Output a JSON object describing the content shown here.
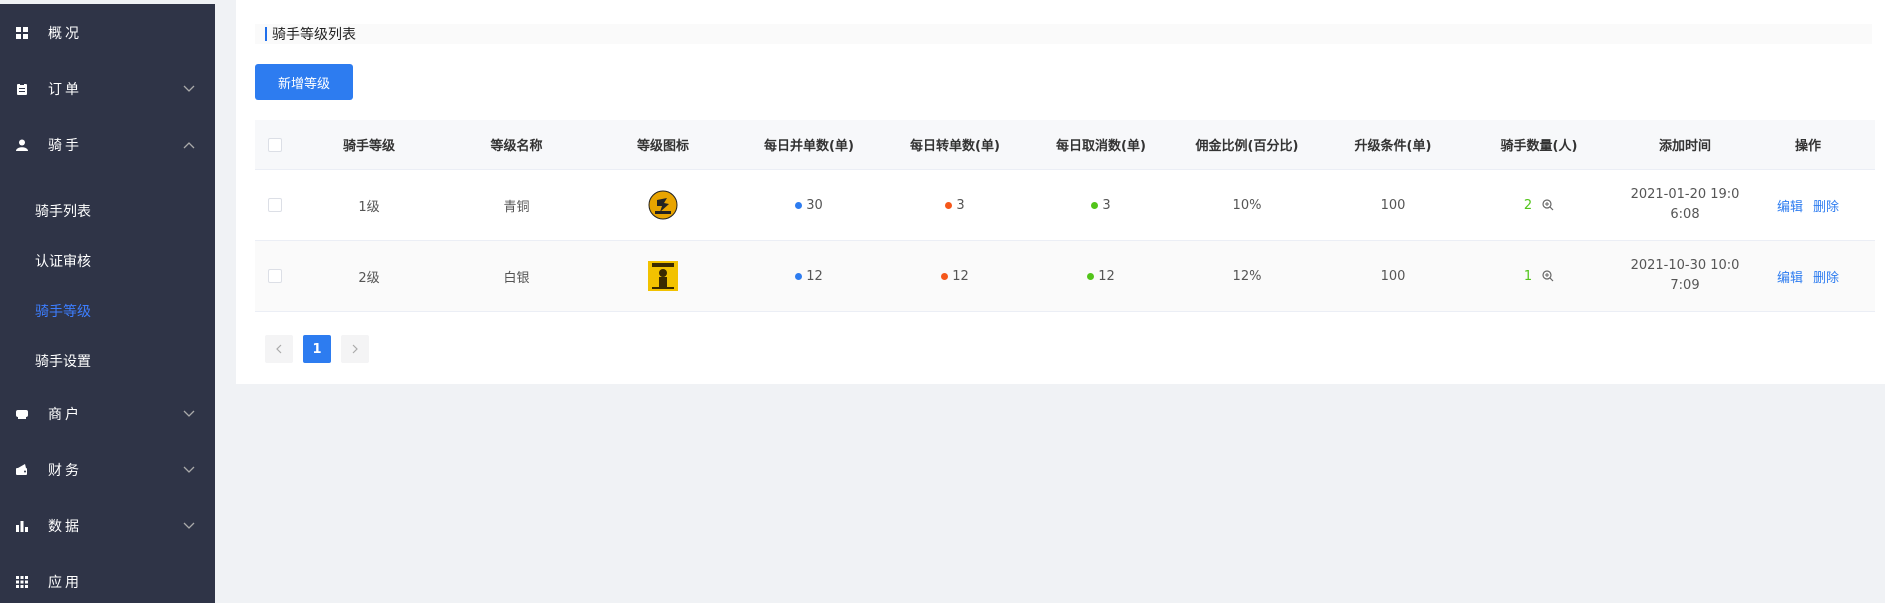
{
  "sidebar": {
    "menus": [
      {
        "label": "概况",
        "icon": "grid-icon",
        "chevron": "none"
      },
      {
        "label": "订单",
        "icon": "clipboard-icon",
        "chevron": "down"
      },
      {
        "label": "骑手",
        "icon": "user-icon",
        "chevron": "up"
      },
      {
        "label": "商户",
        "icon": "shop-icon",
        "chevron": "down"
      },
      {
        "label": "财务",
        "icon": "wallet-icon",
        "chevron": "down"
      },
      {
        "label": "数据",
        "icon": "bar-chart-icon",
        "chevron": "down"
      },
      {
        "label": "应用",
        "icon": "apps-icon",
        "chevron": "none"
      }
    ],
    "sub_items": [
      {
        "label": "骑手列表",
        "active": false
      },
      {
        "label": "认证审核",
        "active": false
      },
      {
        "label": "骑手等级",
        "active": true
      },
      {
        "label": "骑手设置",
        "active": false
      }
    ]
  },
  "page": {
    "title": "骑手等级列表",
    "add_button": "新增等级"
  },
  "table": {
    "headers": [
      "骑手等级",
      "等级名称",
      "等级图标",
      "每日并单数(单)",
      "每日转单数(单)",
      "每日取消数(单)",
      "佣金比例(百分比)",
      "升级条件(单)",
      "骑手数量(人)",
      "添加时间",
      "操作"
    ],
    "rows": [
      {
        "level": "1级",
        "name": "青铜",
        "icon": "bronze-badge-icon",
        "merge": "30",
        "transfer": "3",
        "cancel": "3",
        "commission": "10%",
        "upgrade": "100",
        "riders": "2",
        "time": "2021-01-20 19:06:08"
      },
      {
        "level": "2级",
        "name": "白银",
        "icon": "silver-badge-icon",
        "merge": "12",
        "transfer": "12",
        "cancel": "12",
        "commission": "12%",
        "upgrade": "100",
        "riders": "1",
        "time": "2021-10-30 10:07:09"
      }
    ],
    "actions": {
      "edit": "编辑",
      "delete": "删除"
    }
  },
  "pagination": {
    "current": "1"
  },
  "colors": {
    "sidebar_bg": "#2f3447",
    "accent": "#2d7cf0",
    "merge_dot": "#2d7cf0",
    "transfer_dot": "#f5571a",
    "cancel_dot": "#52c41a",
    "rider_count": "#52c41a"
  }
}
